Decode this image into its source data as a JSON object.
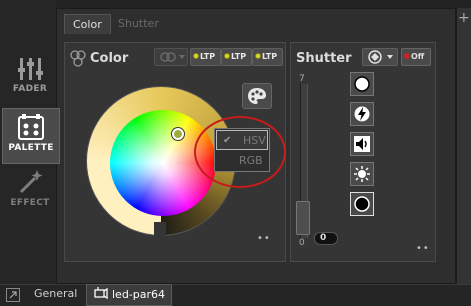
{
  "tabs": [
    {
      "label": "Color",
      "active": true
    },
    {
      "label": "Shutter",
      "active": false
    }
  ],
  "left_tools": [
    {
      "label": "FADER",
      "icon": "sliders-icon"
    },
    {
      "label": "PALETTE",
      "icon": "palette-board-icon",
      "active": true
    },
    {
      "label": "EFFECT",
      "icon": "magic-wand-icon"
    }
  ],
  "color_panel": {
    "title": "Color",
    "ltp_buttons": [
      "LTP",
      "LTP",
      "LTP"
    ],
    "mode_menu": {
      "items": [
        {
          "label": "HSV",
          "checked": true
        },
        {
          "label": "RGB",
          "checked": false
        }
      ]
    },
    "dots": "••"
  },
  "shutter_panel": {
    "title": "Shutter",
    "off_label": "Off",
    "scale_top": "7",
    "scale_bottom": "0",
    "value": "0",
    "dots": "••",
    "buttons": [
      "open-icon",
      "strobe-icon",
      "sound-icon",
      "random-strobe-icon",
      "closed-icon"
    ]
  },
  "bottom_tabs": [
    {
      "label": "General",
      "active": false
    },
    {
      "label": "led-par64",
      "active": true
    }
  ],
  "colors": {
    "accent_red": "#c81c1c",
    "ltp_dot": "#d8d830",
    "background": "#232323"
  }
}
